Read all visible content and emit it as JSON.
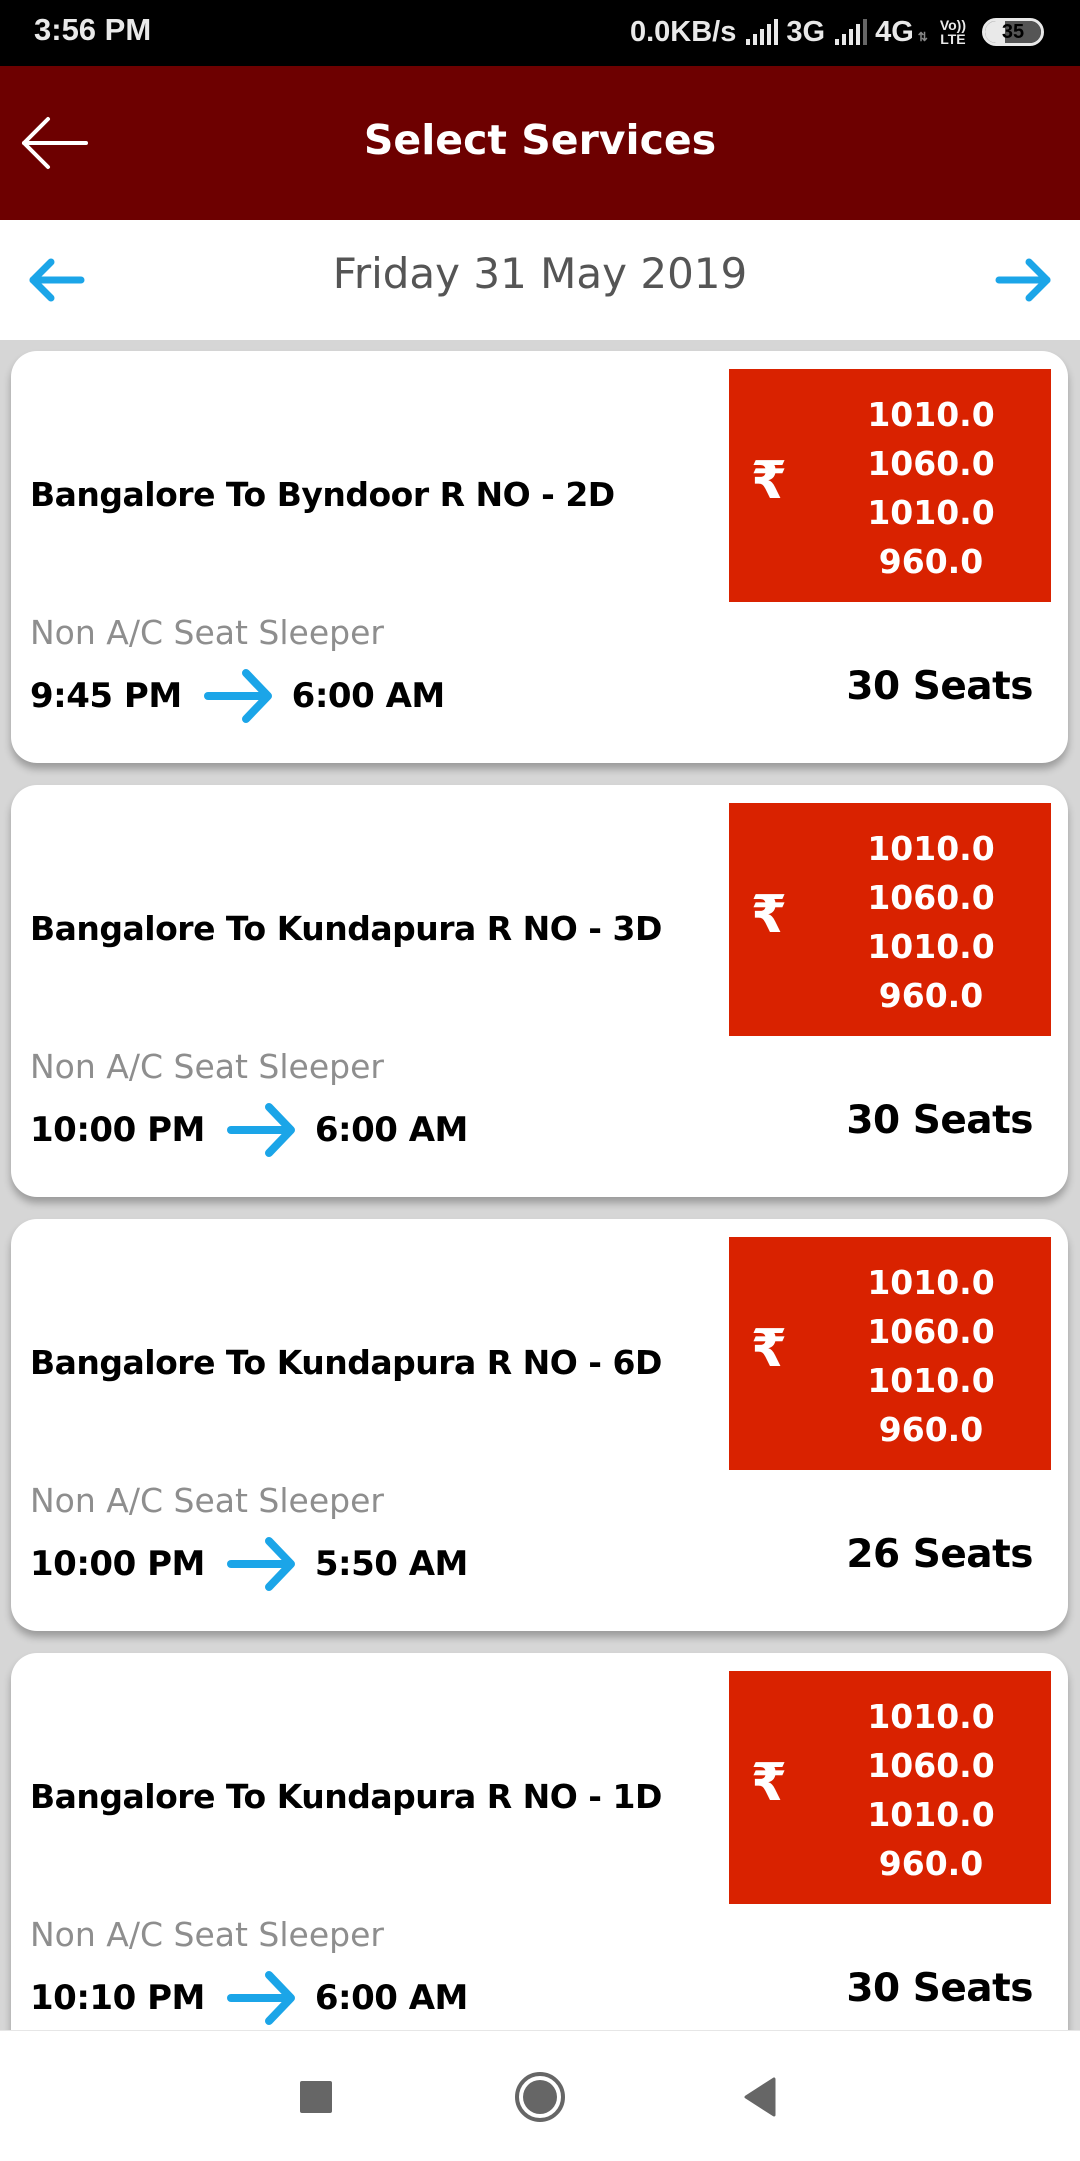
{
  "status_bar": {
    "time": "3:56 PM",
    "network_speed": "0.0KB/s",
    "network_1": "3G",
    "network_2": "4G",
    "volte_top": "Vo))",
    "volte_bottom": "LTE",
    "battery_level": 35,
    "battery_label": "35"
  },
  "header": {
    "title": "Select Services",
    "back_icon": "arrow-left-icon"
  },
  "date_nav": {
    "date": "Friday 31 May 2019",
    "prev_icon": "arrow-left-icon",
    "next_icon": "arrow-right-icon"
  },
  "colors": {
    "header_bg": "#6d0000",
    "price_bg": "#d92200",
    "accent_blue": "#1ba5e8",
    "background": "#d6d6d6"
  },
  "currency_symbol": "₹",
  "services": [
    {
      "title": "Bangalore To Byndoor R NO - 2D",
      "fares": [
        "1010.0",
        "1060.0",
        "1010.0",
        "960.0"
      ],
      "bus_type": "Non A/C Seat Sleeper",
      "departure": "9:45 PM",
      "arrival": "6:00 AM",
      "seats": "30 Seats"
    },
    {
      "title": "Bangalore To Kundapura R NO - 3D",
      "fares": [
        "1010.0",
        "1060.0",
        "1010.0",
        "960.0"
      ],
      "bus_type": "Non A/C Seat Sleeper",
      "departure": "10:00 PM",
      "arrival": "6:00 AM",
      "seats": "30 Seats"
    },
    {
      "title": "Bangalore To Kundapura R NO - 6D",
      "fares": [
        "1010.0",
        "1060.0",
        "1010.0",
        "960.0"
      ],
      "bus_type": "Non A/C Seat Sleeper",
      "departure": "10:00 PM",
      "arrival": "5:50 AM",
      "seats": "26 Seats"
    },
    {
      "title": "Bangalore To Kundapura R NO - 1D",
      "fares": [
        "1010.0",
        "1060.0",
        "1010.0",
        "960.0"
      ],
      "bus_type": "Non A/C Seat Sleeper",
      "departure": "10:10 PM",
      "arrival": "6:00 AM",
      "seats": "30 Seats"
    }
  ],
  "nav_bar": {
    "recents_icon": "square-icon",
    "home_icon": "circle-icon",
    "back_icon": "triangle-back-icon"
  }
}
